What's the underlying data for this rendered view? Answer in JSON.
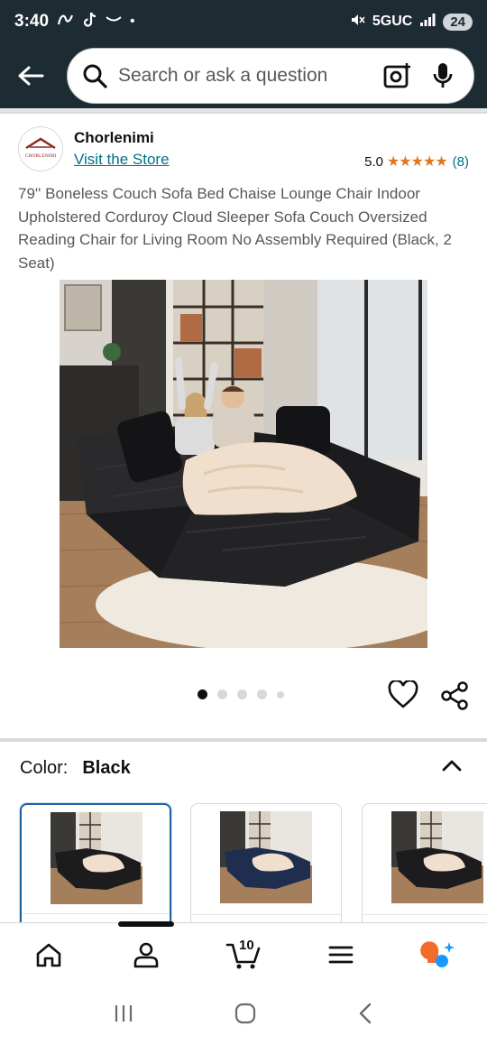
{
  "status_bar": {
    "time": "3:40",
    "network": "5GUC",
    "battery": "24",
    "icons": [
      "airtel-icon",
      "tiktok-icon",
      "amazon-smile-icon",
      "dot-icon",
      "mute-icon",
      "signal-icon"
    ]
  },
  "search": {
    "placeholder": "Search or ask a question",
    "icons": [
      "back-arrow-icon",
      "search-icon",
      "camera-icon",
      "microphone-icon"
    ]
  },
  "store": {
    "name": "Chorlenimi",
    "link": "Visit the Store",
    "logo_text": "CHORLENIMI",
    "rating": "5.0",
    "stars": "★★★★★",
    "review_count": "(8)"
  },
  "product": {
    "title": "79'' Boneless Couch Sofa Bed Chaise Lounge Chair Indoor Upholstered Corduroy Cloud Sleeper Sofa Couch Oversized Reading Chair for Living Room No Assembly Required (Black, 2 Seat)",
    "image_count": 5,
    "active_image": 1
  },
  "color": {
    "label": "Color:",
    "value": "Black",
    "swatches": [
      {
        "name": "Black",
        "selected": true,
        "sofa_color": "#1c1c1e"
      },
      {
        "name": "Blue",
        "selected": false,
        "sofa_color": "#1f2d4f"
      },
      {
        "name": "Black",
        "selected": false,
        "sofa_color": "#1c1c1e"
      }
    ]
  },
  "bottom_nav": {
    "items": [
      "home-icon",
      "account-icon",
      "cart-icon",
      "menu-icon",
      "rufus-icon"
    ],
    "active_index": 1,
    "cart_count": "10"
  },
  "colors": {
    "header_bg": "#1d2b33",
    "link": "#007185",
    "star": "#de7921",
    "selected_border": "#2162a1"
  }
}
